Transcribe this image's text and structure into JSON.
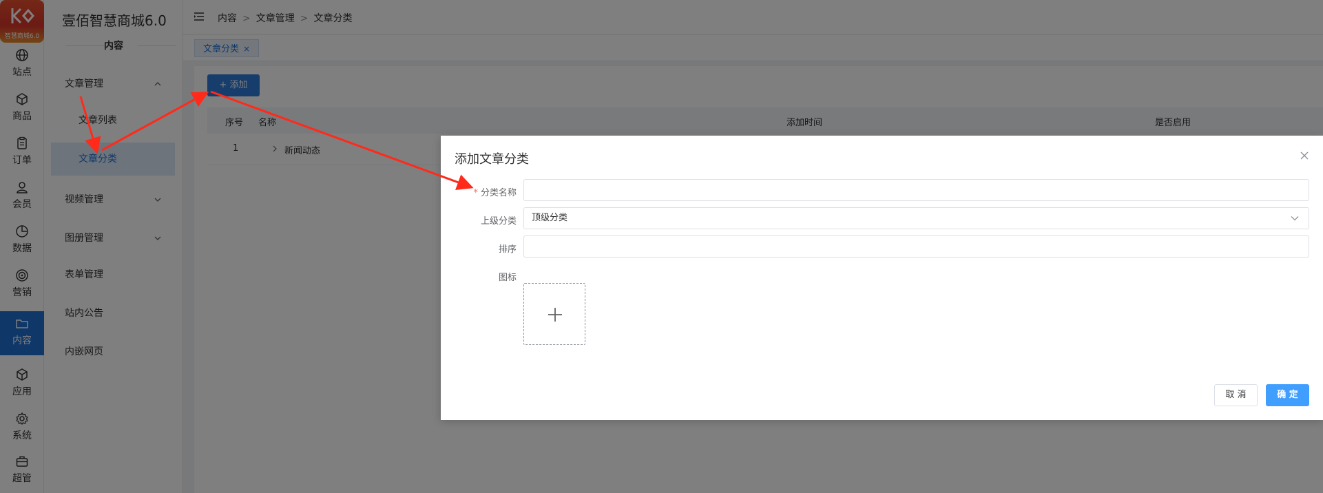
{
  "brand": {
    "title": "壹佰智慧商城6.0",
    "logo_caption": "智慧商城6.0"
  },
  "rail": [
    {
      "label": "站点",
      "icon": "globe-icon"
    },
    {
      "label": "商品",
      "icon": "box-icon"
    },
    {
      "label": "订单",
      "icon": "clipboard-icon"
    },
    {
      "label": "会员",
      "icon": "user-icon"
    },
    {
      "label": "数据",
      "icon": "pie-chart-icon"
    },
    {
      "label": "营销",
      "icon": "target-icon"
    },
    {
      "label": "内容",
      "icon": "folder-icon",
      "active": true
    },
    {
      "label": "应用",
      "icon": "cube-icon"
    },
    {
      "label": "系统",
      "icon": "gear-icon"
    },
    {
      "label": "超管",
      "icon": "briefcase-icon"
    }
  ],
  "sidebar": {
    "section": "内容",
    "items": [
      {
        "label": "文章管理"
      },
      {
        "label": "文章列表"
      },
      {
        "label": "文章分类"
      },
      {
        "label": "视频管理"
      },
      {
        "label": "图册管理"
      },
      {
        "label": "表单管理"
      },
      {
        "label": "站内公告"
      },
      {
        "label": "内嵌网页"
      }
    ]
  },
  "breadcrumb": [
    "内容",
    "文章管理",
    "文章分类"
  ],
  "breadcrumb_sep": ">",
  "tabs": [
    {
      "label": "文章分类",
      "close": "×"
    }
  ],
  "toolbar": {
    "add_label": "+ 添加"
  },
  "table": {
    "headers": [
      "序号",
      "名称",
      "添加时间",
      "是否启用"
    ],
    "rows": [
      {
        "index": "1",
        "name": "新闻动态"
      }
    ]
  },
  "dialog": {
    "title": "添加文章分类",
    "fields": {
      "name_label": "分类名称",
      "name_required": "*",
      "parent_label": "上级分类",
      "parent_value": "顶级分类",
      "sort_label": "排序",
      "icon_label": "图标"
    },
    "cancel_label": "取 消",
    "ok_label": "确 定"
  },
  "colors": {
    "primary": "#1f6fd1",
    "confirm": "#409eff",
    "annotation_arrow": "#ff2a1a"
  }
}
